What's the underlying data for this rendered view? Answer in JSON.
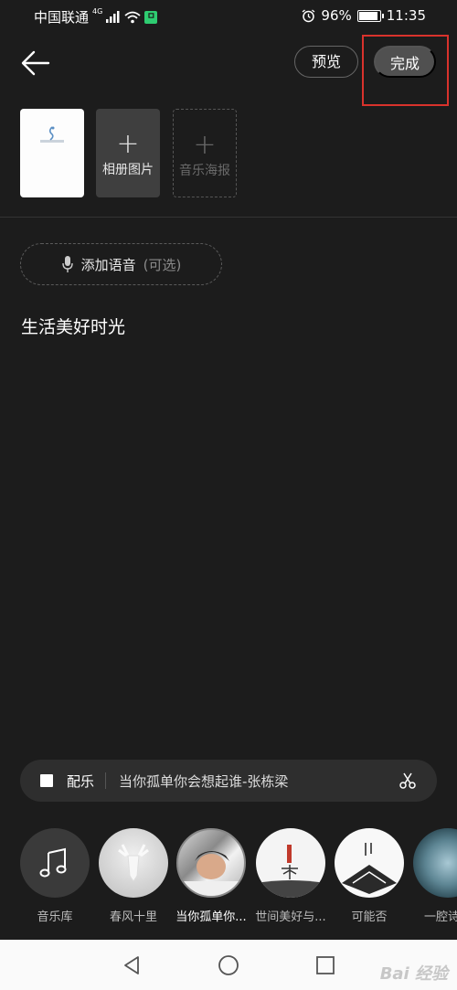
{
  "status_bar": {
    "carrier": "中国联通",
    "network": "4G",
    "battery": "96%",
    "time": "11:35"
  },
  "header": {
    "preview_label": "预览",
    "done_label": "完成"
  },
  "thumbnails": {
    "album_label": "相册图片",
    "music_poster_label": "音乐海报"
  },
  "voice": {
    "label": "添加语音",
    "optional": "(可选)"
  },
  "caption": "生活美好时光",
  "music_bar": {
    "label": "配乐",
    "song": "当你孤单你会想起谁-张栋梁"
  },
  "songs": [
    {
      "name": "音乐库"
    },
    {
      "name": "春风十里"
    },
    {
      "name": "当你孤单你..."
    },
    {
      "name": "世间美好与..."
    },
    {
      "name": "可能否"
    },
    {
      "name": "一腔诗意"
    }
  ],
  "colors": {
    "background": "#1c1c1c",
    "highlight": "#d9322c",
    "done_button": "#505050"
  },
  "watermark": "Bai 经验"
}
